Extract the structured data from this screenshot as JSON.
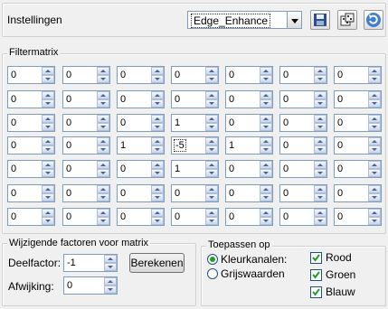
{
  "header": {
    "settings_label": "Instellingen",
    "preset_value": "Edge_Enhance",
    "icons": [
      "save-icon",
      "randomize-dice-icon",
      "reset-icon"
    ]
  },
  "matrix": {
    "title": "Filtermatrix",
    "rows": [
      [
        "0",
        "0",
        "0",
        "0",
        "0",
        "0",
        "0"
      ],
      [
        "0",
        "0",
        "0",
        "0",
        "0",
        "0",
        "0"
      ],
      [
        "0",
        "0",
        "0",
        "1",
        "0",
        "0",
        "0"
      ],
      [
        "0",
        "0",
        "1",
        "-5",
        "1",
        "0",
        "0"
      ],
      [
        "0",
        "0",
        "0",
        "1",
        "0",
        "0",
        "0"
      ],
      [
        "0",
        "0",
        "0",
        "0",
        "0",
        "0",
        "0"
      ],
      [
        "0",
        "0",
        "0",
        "0",
        "0",
        "0",
        "0"
      ]
    ]
  },
  "factors": {
    "title": "Wijzigende factoren voor matrix",
    "divisor_label": "Deelfactor:",
    "divisor_value": "-1",
    "bias_label": "Afwijking:",
    "bias_value": "0",
    "compute_label": "Berekenen"
  },
  "apply": {
    "title": "Toepassen op",
    "color_channels_label": "Kleurkanalen:",
    "grayscale_label": "Grijswaarden",
    "selected_mode": "color",
    "red_label": "Rood",
    "green_label": "Groen",
    "blue_label": "Blauw",
    "red_checked": true,
    "green_checked": true,
    "blue_checked": true
  },
  "colors": {
    "accent": "#21a121",
    "border": "#7f9db9"
  }
}
